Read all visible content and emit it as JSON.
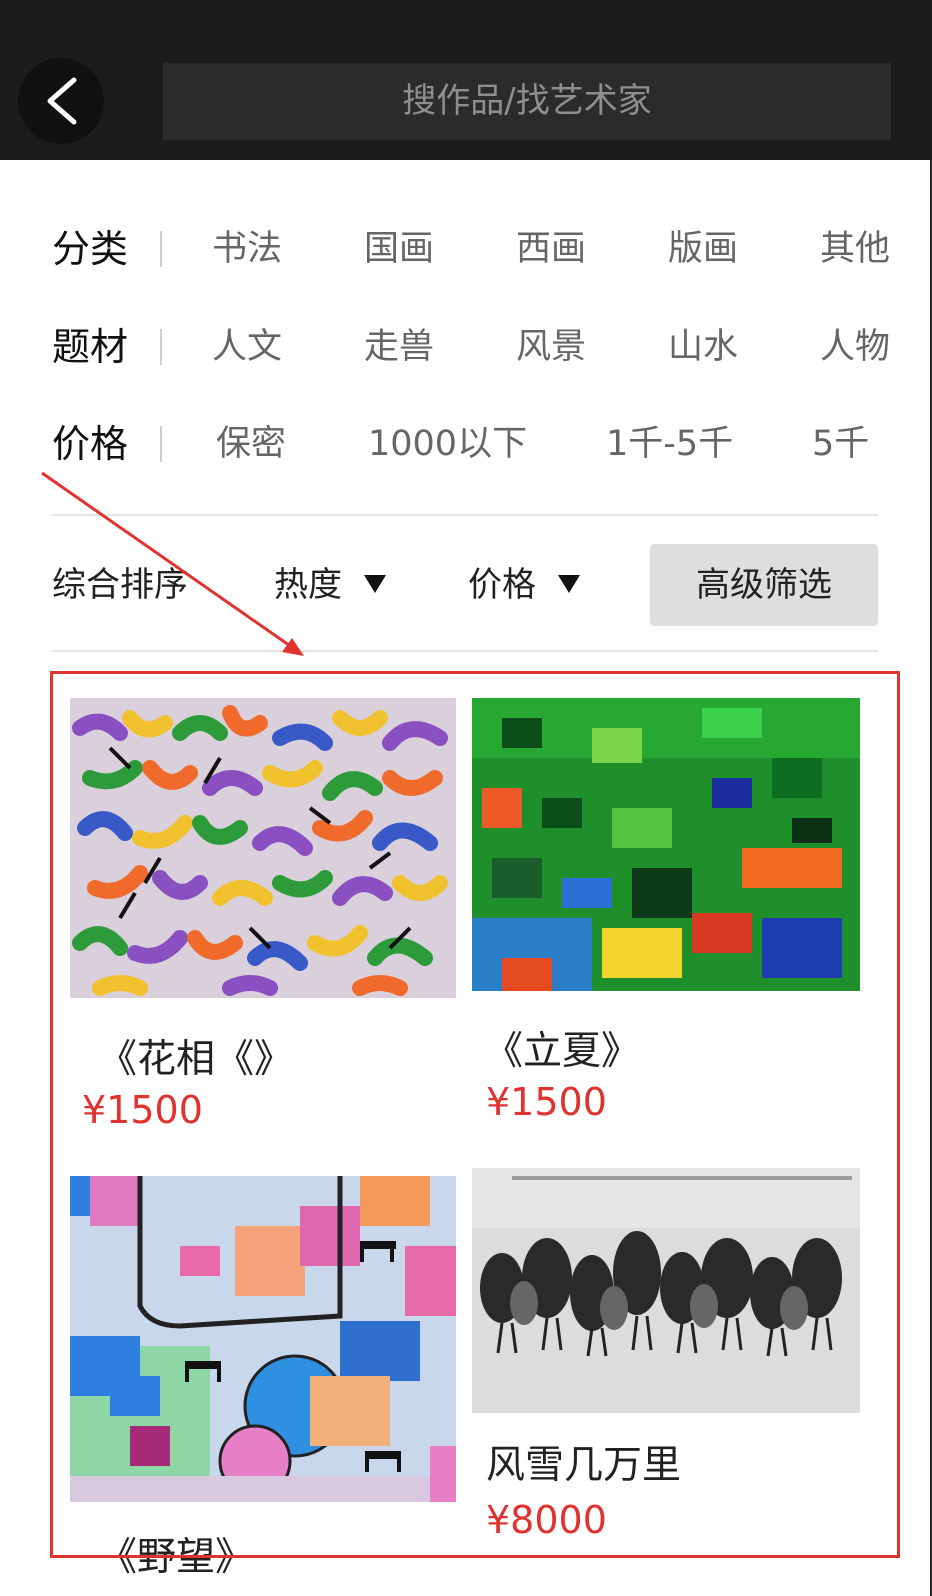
{
  "header": {
    "search_placeholder": "搜作品/找艺术家"
  },
  "filters": {
    "category": {
      "label": "分类",
      "options": [
        "书法",
        "国画",
        "西画",
        "版画",
        "其他"
      ]
    },
    "subject": {
      "label": "题材",
      "options": [
        "人文",
        "走兽",
        "风景",
        "山水",
        "人物"
      ]
    },
    "price": {
      "label": "价格",
      "options": [
        "保密",
        "1000以下",
        "1千-5千",
        "5千"
      ]
    }
  },
  "sort": {
    "overall": "综合排序",
    "heat": "热度",
    "price": "价格",
    "advanced": "高级筛选"
  },
  "artworks": [
    {
      "title": "《花相《》",
      "price": "¥1500"
    },
    {
      "title": "《立夏》",
      "price": "¥1500"
    },
    {
      "title": "《野望》",
      "price": ""
    },
    {
      "title": "风雪几万里",
      "price": "¥8000"
    }
  ],
  "colors": {
    "header_bg": "#1c1c1c",
    "price_red": "#e0332f",
    "annotation_red": "#e0332f"
  }
}
